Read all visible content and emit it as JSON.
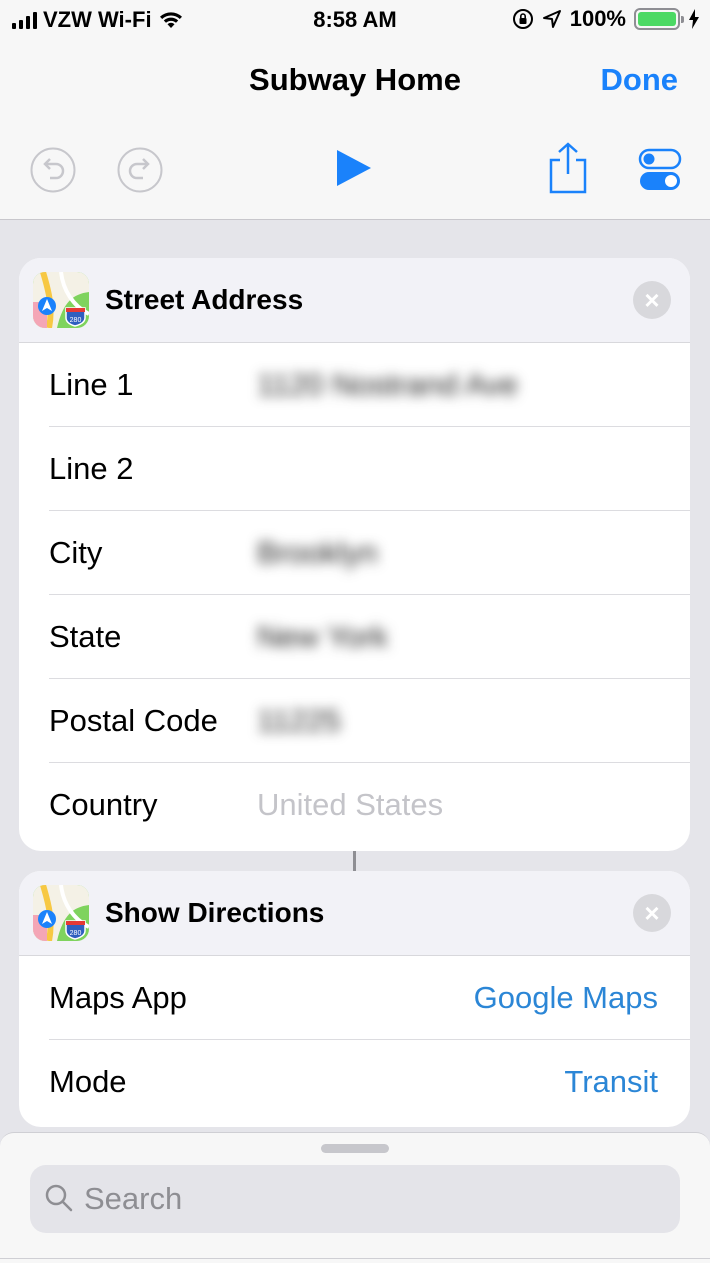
{
  "status_bar": {
    "carrier": "VZW Wi-Fi",
    "time": "8:58 AM",
    "battery": "100%",
    "battery_color": "#4cd964"
  },
  "nav": {
    "title": "Subway Home",
    "done_label": "Done",
    "accent": "#1a82fb"
  },
  "toolbar": {
    "icons": [
      "undo-icon",
      "redo-icon",
      "play-icon",
      "share-icon",
      "settings-toggle-icon"
    ]
  },
  "street_address": {
    "title": "Street Address",
    "rows": [
      {
        "label": "Line 1",
        "value": "1120 Nostrand Ave"
      },
      {
        "label": "Line 2",
        "value": ""
      },
      {
        "label": "City",
        "value": "Brooklyn"
      },
      {
        "label": "State",
        "value": "New York"
      },
      {
        "label": "Postal Code",
        "value": "11225"
      },
      {
        "label": "Country",
        "placeholder": "United States"
      }
    ]
  },
  "show_directions": {
    "title": "Show Directions",
    "rows": [
      {
        "label": "Maps App",
        "value": "Google Maps"
      },
      {
        "label": "Mode",
        "value": "Transit"
      }
    ]
  },
  "search": {
    "placeholder": "Search"
  }
}
